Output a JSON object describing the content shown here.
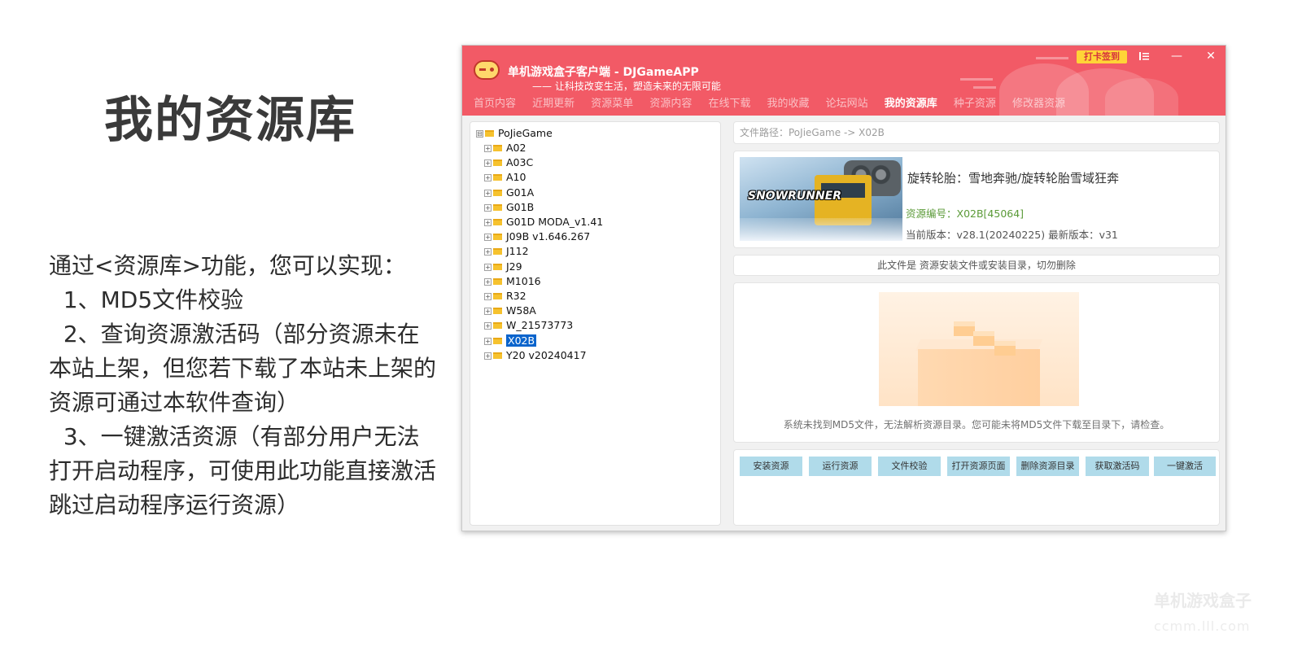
{
  "slide": {
    "title": "我的资源库",
    "body": [
      "通过<资源库>功能，您可以实现：",
      "  1、MD5文件校验",
      "  2、查询资源激活码（部分资源未在本站上架，但您若下载了本站未上架的资源可通过本软件查询）",
      "  3、一键激活资源（有部分用户无法打开启动程序，可使用此功能直接激活跳过启动程序运行资源）"
    ]
  },
  "window": {
    "app_title": "单机游戏盒子客户端 - DJGameAPP",
    "slogan": "—— 让科技改变生活，塑造未来的无限可能",
    "signin_label": "打卡签到",
    "menu_icon": "list-icon",
    "minimize_glyph": "—",
    "close_glyph": "✕",
    "accent_color": "#f25a66",
    "nav": [
      {
        "label": "首页内容",
        "active": false
      },
      {
        "label": "近期更新",
        "active": false
      },
      {
        "label": "资源菜单",
        "active": false
      },
      {
        "label": "资源内容",
        "active": false
      },
      {
        "label": "在线下载",
        "active": false
      },
      {
        "label": "我的收藏",
        "active": false
      },
      {
        "label": "论坛网站",
        "active": false
      },
      {
        "label": "我的资源库",
        "active": true
      },
      {
        "label": "种子资源",
        "active": false
      },
      {
        "label": "修改器资源",
        "active": false
      }
    ]
  },
  "tree": {
    "root": {
      "label": "PoJieGame",
      "toggle": "⊟"
    },
    "items": [
      {
        "label": "A02",
        "selected": false
      },
      {
        "label": "A03C",
        "selected": false
      },
      {
        "label": "A10",
        "selected": false
      },
      {
        "label": "G01A",
        "selected": false
      },
      {
        "label": "G01B",
        "selected": false
      },
      {
        "label": "G01D MODA_v1.41",
        "selected": false
      },
      {
        "label": "J09B v1.646.267",
        "selected": false
      },
      {
        "label": "J112",
        "selected": false
      },
      {
        "label": "J29",
        "selected": false
      },
      {
        "label": "M1016",
        "selected": false
      },
      {
        "label": "R32",
        "selected": false
      },
      {
        "label": "W58A",
        "selected": false
      },
      {
        "label": "W_21573773",
        "selected": false
      },
      {
        "label": "X02B",
        "selected": true
      },
      {
        "label": "Y20 v20240417",
        "selected": false
      }
    ],
    "expand_glyph": "+"
  },
  "detail": {
    "path": "文件路径：PoJieGame -> X02B",
    "cover_logo": "SNOWRUNNER",
    "game_name": "旋转轮胎：雪地奔驰/旋转轮胎雪域狂奔",
    "resource_id": "资源编号：X02B[45064]",
    "version": "当前版本：v28.1(20240225) 最新版本：v31",
    "notice": "此文件是 资源安装文件或安装目录，切勿删除",
    "empty_message": "系统未找到MD5文件，无法解析资源目录。您可能未将MD5文件下载至目录下，请检查。",
    "actions": [
      "安装资源",
      "运行资源",
      "文件校验",
      "打开资源页面",
      "删除资源目录",
      "获取激活码",
      "一键激活"
    ],
    "button_color": "#b0dbea"
  },
  "watermark": {
    "text": "单机游戏盒子",
    "sub": "ccmm.lll.com"
  }
}
